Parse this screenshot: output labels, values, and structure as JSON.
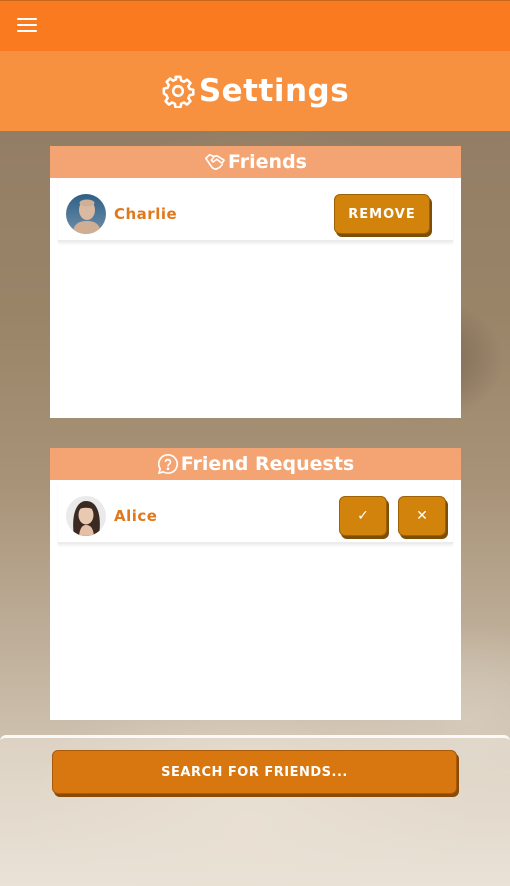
{
  "topbar": {
    "menu_icon": "hamburger-menu-icon"
  },
  "header": {
    "title": "Settings",
    "icon": "gear-icon"
  },
  "friends": {
    "title": "Friends",
    "icon": "handshake-icon",
    "items": [
      {
        "name": "Charlie",
        "action_label": "REMOVE"
      }
    ]
  },
  "requests": {
    "title": "Friend Requests",
    "icon": "question-chat-icon",
    "items": [
      {
        "name": "Alice",
        "accept_label": "✓",
        "decline_label": "✕"
      }
    ]
  },
  "search": {
    "label": "SEARCH FOR FRIENDS..."
  },
  "colors": {
    "accent": "#f97a1f",
    "header": "#f8913f",
    "panel_header": "#f4a472",
    "button": "#d1830b",
    "name_text": "#e0781c"
  }
}
